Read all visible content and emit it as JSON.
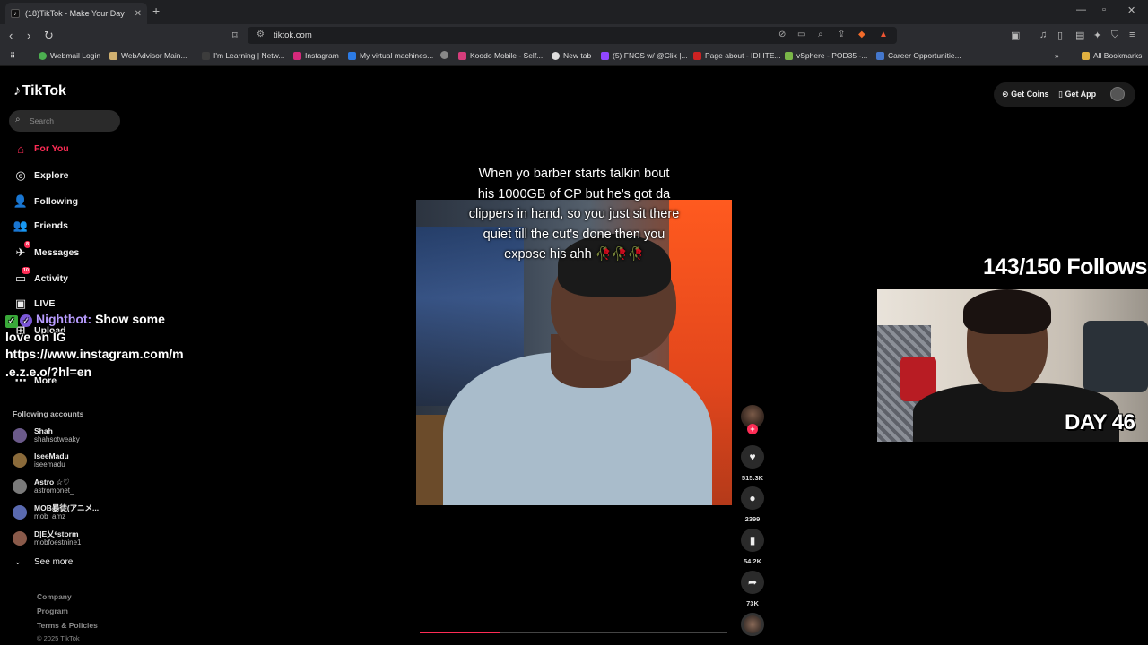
{
  "browser": {
    "tab_title": "(18)TikTok - Make Your Day",
    "tab_close": "✕",
    "new_tab": "+",
    "url": "tiktok.com",
    "bookmarks": [
      "Webmail Login",
      "WebAdvisor Main...",
      "I'm Learning | Netw...",
      "Instagram",
      "My virtual machines...",
      "Koodo Mobile - Self...",
      "New tab",
      "(5) FNCS w/ @Clix |...",
      "Page about - IDI ITE...",
      "vSphere - POD35 -...",
      "Career Opportunitie..."
    ],
    "all_bookmarks": "All Bookmarks"
  },
  "tiktok": {
    "logo": "TikTok",
    "search_placeholder": "Search",
    "nav": [
      {
        "label": "For You",
        "icon": "home-icon"
      },
      {
        "label": "Explore",
        "icon": "compass-icon"
      },
      {
        "label": "Following",
        "icon": "following-icon"
      },
      {
        "label": "Friends",
        "icon": "friends-icon"
      },
      {
        "label": "Messages",
        "icon": "messages-icon",
        "badge": "8"
      },
      {
        "label": "Activity",
        "icon": "activity-icon",
        "badge": "10"
      },
      {
        "label": "LIVE",
        "icon": "live-icon"
      },
      {
        "label": "Upload",
        "icon": "upload-icon"
      },
      {
        "label": "More",
        "icon": "more-icon"
      }
    ],
    "following_title": "Following accounts",
    "accounts": [
      {
        "name": "Shah",
        "handle": "shahsotweaky",
        "color": "#6b5a8a"
      },
      {
        "name": "IseeMadu",
        "handle": "iseemadu",
        "color": "#8a6a3a"
      },
      {
        "name": "Astro ☆♡",
        "handle": "astromonet_",
        "color": "#7a7a7a"
      },
      {
        "name": "MOB暴徒(アニメ...",
        "handle": "mob_amz",
        "color": "#5a6ab0"
      },
      {
        "name": "D|E乂ᵉstorm",
        "handle": "mobfoestnine1",
        "color": "#8a5a4a"
      }
    ],
    "see_more": "See more",
    "footer": [
      "Company",
      "Program",
      "Terms & Policies"
    ],
    "copyright": "© 2025 TikTok",
    "get_coins": "Get Coins",
    "get_app": "Get App",
    "video": {
      "caption_lines": [
        "When yo barber starts talkin bout",
        "his 1000GB of CP but he's got da",
        "clippers in hand, so you just sit there",
        "quiet till the cut's done then you",
        "expose his ahh 🥀🥀🥀"
      ],
      "progress": 0.26,
      "likes": "515.3K",
      "comments": "2399",
      "saves": "54.2K",
      "shares": "73K"
    }
  },
  "overlay": {
    "nightbot_name": "Nightbot:",
    "nightbot_msg_1": "Show some",
    "nightbot_msg_2": "love on IG",
    "nightbot_msg_3": "https://www.instagram.com/m",
    "nightbot_msg_4": ".e.z.e.o/?hl=en",
    "follows": "143/150 Follows",
    "day": "DAY 46"
  }
}
